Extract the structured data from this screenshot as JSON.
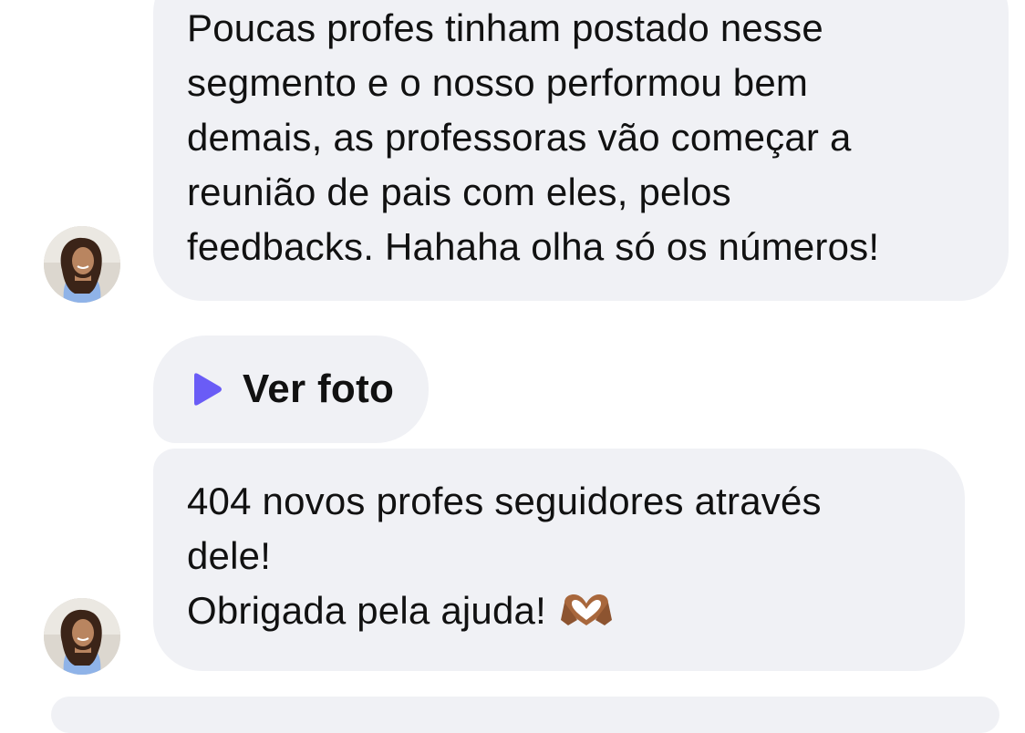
{
  "messages": [
    {
      "lines": [
        "Poucas profes tinham postado nesse",
        "segmento e o nosso performou bem",
        "demais, as professoras vão começar a",
        "reunião de pais com eles, pelos",
        "feedbacks. Hahaha olha só os números!"
      ]
    },
    {
      "attachment_label": "Ver foto",
      "attachment_icon": "play-icon",
      "accent_color": "#6a5cf6"
    },
    {
      "lines": [
        "404 novos profes seguidores através",
        "dele!",
        "Obrigada pela ajuda!"
      ],
      "emoji": "heart-hands-icon"
    }
  ],
  "avatar_icon": "contact-avatar"
}
